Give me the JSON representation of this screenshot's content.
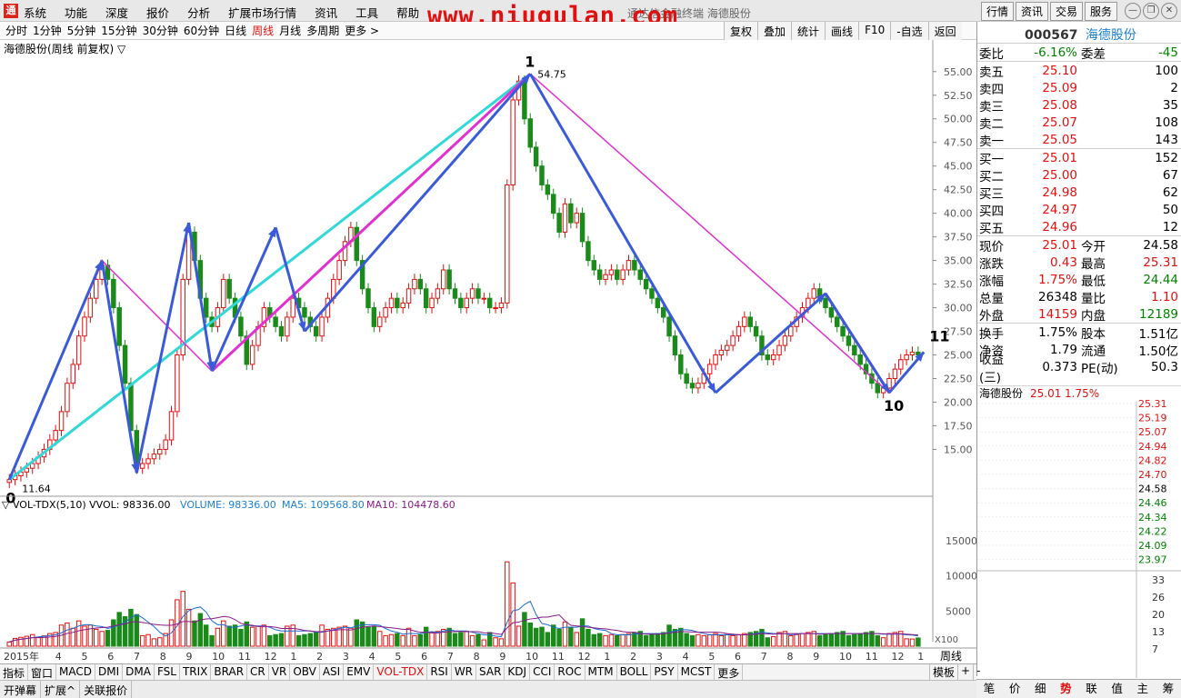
{
  "menu": [
    "系统",
    "功能",
    "深度",
    "报价",
    "分析",
    "扩展市场行情",
    "资讯",
    "工具",
    "帮助"
  ],
  "watermark": "www.niugulan.com",
  "window_title": "通达信金融终端 海德股份",
  "right_buttons": [
    "行情",
    "资讯",
    "交易",
    "服务"
  ],
  "periods": [
    "分时",
    "1分钟",
    "5分钟",
    "15分钟",
    "30分钟",
    "60分钟",
    "日线",
    "周线",
    "月线",
    "多周期",
    "更多 >"
  ],
  "active_period": "周线",
  "tools": [
    "复权",
    "叠加",
    "统计",
    "画线",
    "F10",
    "-自选",
    "返回"
  ],
  "chart_title": "海德股份(周线 前复权) ▽",
  "vol_title": "▽ VOL-TDX(5,10)  VVOL: 98336.00",
  "vol_label": "VOLUME: 98336.00",
  "ma5_label": "MA5: 109568.80",
  "ma10_label": "MA10: 104478.60",
  "price_ticks": [
    "55.00",
    "52.50",
    "50.00",
    "47.50",
    "45.00",
    "42.50",
    "40.00",
    "37.50",
    "35.00",
    "32.50",
    "30.00",
    "27.50",
    "25.00",
    "22.50",
    "20.00",
    "17.50",
    "15.00"
  ],
  "vol_ticks": [
    "15000",
    "10000",
    "5000"
  ],
  "vol_unit": "X100",
  "x_axis": [
    "2015年",
    "4",
    "5",
    "6",
    "7",
    "8",
    "9",
    "10",
    "11",
    "12",
    "1",
    "2",
    "3",
    "4",
    "5",
    "6",
    "7",
    "8",
    "9",
    "10",
    "11",
    "12",
    "1",
    "2",
    "3",
    "4",
    "5",
    "6",
    "7",
    "8",
    "9",
    "10",
    "11",
    "12",
    "1"
  ],
  "period_label": "周线",
  "wave_labels": {
    "w0": "0",
    "w1": "1",
    "w10": "10",
    "w11": "11",
    "high": "54.75",
    "low": "11.64"
  },
  "quote": {
    "code": "000567",
    "name": "海德股份",
    "weibi_label": "委比",
    "weibi": "-6.16%",
    "weicha_label": "委差",
    "weicha": "-45",
    "sells": [
      {
        "l": "卖五",
        "p": "25.10",
        "v": "100"
      },
      {
        "l": "卖四",
        "p": "25.09",
        "v": "2"
      },
      {
        "l": "卖三",
        "p": "25.08",
        "v": "35"
      },
      {
        "l": "卖二",
        "p": "25.07",
        "v": "108"
      },
      {
        "l": "卖一",
        "p": "25.05",
        "v": "143"
      }
    ],
    "buys": [
      {
        "l": "买一",
        "p": "25.01",
        "v": "152"
      },
      {
        "l": "买二",
        "p": "25.00",
        "v": "67"
      },
      {
        "l": "买三",
        "p": "24.98",
        "v": "62"
      },
      {
        "l": "买四",
        "p": "24.97",
        "v": "50"
      },
      {
        "l": "买五",
        "p": "24.96",
        "v": "12"
      }
    ],
    "stats": [
      {
        "l": "现价",
        "v": "25.01",
        "c": "red",
        "l2": "今开",
        "v2": "24.58",
        "c2": "k"
      },
      {
        "l": "涨跌",
        "v": "0.43",
        "c": "red",
        "l2": "最高",
        "v2": "25.31",
        "c2": "red"
      },
      {
        "l": "涨幅",
        "v": "1.75%",
        "c": "red",
        "l2": "最低",
        "v2": "24.44",
        "c2": "green"
      },
      {
        "l": "总量",
        "v": "26348",
        "c": "k",
        "l2": "量比",
        "v2": "1.10",
        "c2": "red"
      },
      {
        "l": "外盘",
        "v": "14159",
        "c": "red",
        "l2": "内盘",
        "v2": "12189",
        "c2": "green"
      }
    ],
    "stats2": [
      {
        "l": "换手",
        "v": "1.75%",
        "c": "k",
        "l2": "股本",
        "v2": "1.51亿",
        "c2": "k"
      },
      {
        "l": "净资",
        "v": "1.79",
        "c": "k",
        "l2": "流通",
        "v2": "1.50亿",
        "c2": "k"
      },
      {
        "l": "收益(三)",
        "v": "0.373",
        "c": "k",
        "l2": "PE(动)",
        "v2": "50.3",
        "c2": "k"
      }
    ],
    "mini_title": "海德股份",
    "mini_price": "25.01",
    "mini_pct": "1.75%",
    "mini_ticks": [
      "25.31",
      "25.19",
      "25.07",
      "24.94",
      "24.82",
      "24.70",
      "24.58",
      "24.46",
      "24.34",
      "24.22",
      "24.09",
      "23.97"
    ],
    "mini_vol_ticks": [
      "33",
      "26",
      "20",
      "13",
      "7"
    ]
  },
  "bottom_tabs": [
    "笔",
    "价",
    "细",
    "势",
    "联",
    "值",
    "主",
    "筹"
  ],
  "active_bottom_tab": "势",
  "indicators": [
    "指标",
    "窗口",
    "MACD",
    "DMI",
    "DMA",
    "FSL",
    "TRIX",
    "BRAR",
    "CR",
    "VR",
    "OBV",
    "ASI",
    "EMV",
    "VOL-TDX",
    "RSI",
    "WR",
    "SAR",
    "KDJ",
    "CCI",
    "ROC",
    "MTM",
    "BOLL",
    "PSY",
    "MCST",
    "更多"
  ],
  "active_indicator": "VOL-TDX",
  "side_tabs": [
    "模板",
    "+",
    "-"
  ],
  "status": [
    "开弹幕",
    "扩展^",
    "关联报价"
  ],
  "chart_data": {
    "type": "candlestick",
    "title": "海德股份(周线 前复权)",
    "ylim": [
      11,
      57
    ],
    "y_ticks": [
      15,
      17.5,
      20,
      22.5,
      25,
      27.5,
      30,
      32.5,
      35,
      37.5,
      40,
      42.5,
      45,
      47.5,
      50,
      52.5,
      55
    ],
    "wave_points": [
      {
        "label": "0",
        "value": 11.64
      },
      {
        "label": "1",
        "value": 54.75
      },
      {
        "label": "10",
        "value": 21
      },
      {
        "label": "11",
        "value": 25.3
      }
    ],
    "closes": [
      11.8,
      12.2,
      12.6,
      13,
      13.5,
      14.2,
      15,
      16,
      17,
      19,
      22,
      24,
      27,
      29,
      31,
      33,
      34.5,
      33,
      30,
      26,
      22,
      17,
      13,
      13.5,
      14,
      14.5,
      15,
      16,
      19,
      25,
      33,
      38,
      35,
      31,
      29,
      28,
      30,
      33,
      31,
      29,
      27,
      24,
      26,
      28,
      30,
      29,
      28,
      27,
      29,
      31,
      30,
      29,
      28,
      27,
      29,
      31,
      33,
      35,
      37,
      38.5,
      35,
      32,
      30,
      28,
      29,
      30,
      31,
      30,
      30.5,
      32,
      33,
      32,
      30,
      31,
      32,
      34,
      32,
      31,
      30,
      31,
      32,
      31,
      31,
      30,
      30,
      30.5,
      43,
      52,
      54,
      50,
      47,
      45,
      43,
      42,
      40,
      38,
      41,
      39,
      40,
      37,
      35,
      34,
      33,
      33.5,
      34,
      33,
      34,
      35,
      34,
      33,
      32,
      31,
      30,
      29,
      27,
      25,
      23,
      22,
      21.5,
      22,
      23,
      24,
      25,
      25.5,
      26,
      27,
      28,
      29,
      28,
      27,
      25,
      24.5,
      25,
      26,
      27,
      28,
      29,
      30,
      31,
      32,
      31,
      30,
      29,
      28,
      27,
      26,
      25,
      24,
      23,
      22,
      21,
      21.5,
      22.5,
      23.5,
      24.5,
      25,
      25.3,
      25
    ],
    "volume": {
      "series": [
        {
          "name": "VOLUME"
        },
        {
          "name": "MA5"
        },
        {
          "name": "MA10"
        }
      ],
      "latest": {
        "VOLUME": 98336,
        "MA5": 109568.8,
        "MA10": 104478.6
      }
    }
  }
}
